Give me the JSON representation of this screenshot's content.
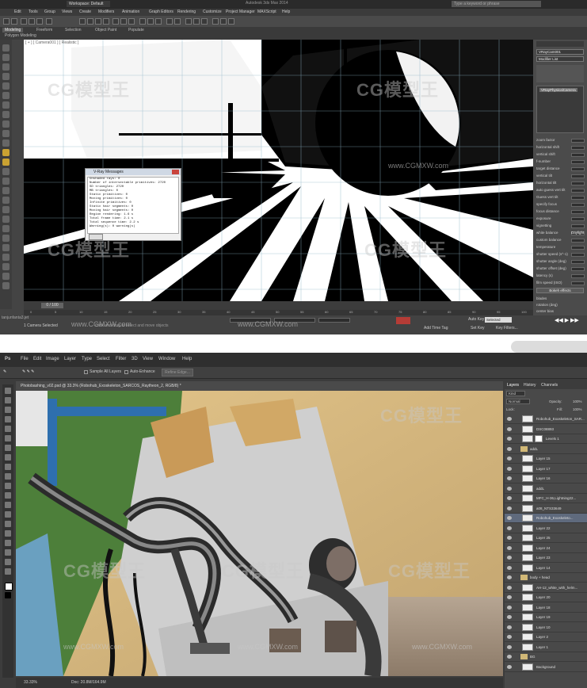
{
  "max": {
    "workspace": "Workspace: Default",
    "doc_title": "Autodesk 3ds Max 2014",
    "search_placeholder": "Type a keyword or phrase",
    "menu": [
      "Edit",
      "Tools",
      "Group",
      "Views",
      "Create",
      "Modifiers",
      "Animation",
      "Graph Editors",
      "Rendering",
      "Customize",
      "Project Manager",
      "MAXScript",
      "Help"
    ],
    "ribbon_tabs": [
      "Modeling",
      "Freeform",
      "Selection",
      "Object Paint",
      "Populate"
    ],
    "ribbon_sub": "Polygon Modeling",
    "viewport_label": "[ + ] [ Camera001 ] [ Realistic ]",
    "render_dialog": {
      "title": "V-Ray Messages",
      "lines": [
        "Unshaded rays: 0",
        "Number of intersectable primitives: 2720",
        "SD triangles: 2720",
        "MB triangles: 0",
        "Static primitives: 0",
        "Moving primitives: 0",
        "Infinite primitives: 0",
        "Static hair segments: 0",
        "Moving hair segments: 0",
        "Region rendering: 1.6 s",
        "Total frame time: 2.1 s",
        "Total sequence time: 2.2 s",
        "Warning(s): 0 warning(s)"
      ]
    },
    "command_panel": {
      "object_name": "VRayCam001",
      "modifier_list": "Modifier List",
      "stack_item": "VRayPhysicalCamera",
      "params": [
        "zoom factor",
        "horizontal shift",
        "vertical shift",
        "f-number",
        "target distance",
        "vertical tilt",
        "horizontal tilt",
        "auto guess vert tilt",
        "Guess vert tilt",
        "specify focus",
        "focus distance",
        "exposure",
        "vignetting",
        "white balance",
        "custom balance",
        "temperature",
        "shutter speed (s^-1)",
        "shutter angle (deg)",
        "shutter offset (deg)",
        "latency (s)",
        "film speed (ISO)"
      ],
      "white_balance": "Daylight",
      "rollout": "Bokeh effects",
      "blades": "blades",
      "rotation": "rotation (deg)",
      "center_bias": "center bias"
    },
    "timeline": {
      "frame": "0 / 100",
      "ticks": [
        "0",
        "5",
        "10",
        "15",
        "20",
        "25",
        "30",
        "35",
        "40",
        "45",
        "50",
        "55",
        "60",
        "65",
        "70",
        "75",
        "80",
        "85",
        "90",
        "95",
        "100"
      ]
    },
    "status": {
      "selected": "1 Camera Selected",
      "hint": "Click and drag to select and move objects",
      "auto_key": "Auto Key",
      "set_key": "Set Key",
      "selection": "Selected",
      "key_filters": "Key Filters...",
      "add_time_tag": "Add Time Tag",
      "lower_left": "tanjunfanta3.jet"
    }
  },
  "ps": {
    "menu": [
      "File",
      "Edit",
      "Image",
      "Layer",
      "Type",
      "Select",
      "Filter",
      "3D",
      "View",
      "Window",
      "Help"
    ],
    "options": {
      "sample_all": "Sample All Layers",
      "auto_enhance": "Auto-Enhance",
      "refine": "Refine Edge..."
    },
    "doc_tab": "Photobashing_v02.psd @ 33.3% (Robohub_Exoskeleton_SARCOS_Raytheon_2, RGB/8) *",
    "zoom": "33.33%",
    "doc_size": "Doc: 20.8M/164.9M",
    "panel_tabs": [
      "Layers",
      "History",
      "Channels"
    ],
    "kind": "Kind",
    "blend": "Normal",
    "opacity_label": "Opacity:",
    "opacity": "100%",
    "lock_label": "Lock:",
    "fill_label": "Fill:",
    "fill": "100%",
    "layers": [
      {
        "name": "Robohub_Exoskeleton_SAR...",
        "type": "layer"
      },
      {
        "name": "DSC08893",
        "type": "layer"
      },
      {
        "name": "Levels 1",
        "type": "adj"
      },
      {
        "name": "addL",
        "type": "group"
      },
      {
        "name": "Layer 15",
        "type": "layer"
      },
      {
        "name": "Layer 17",
        "type": "layer"
      },
      {
        "name": "Layer 16",
        "type": "layer"
      },
      {
        "name": "addL",
        "type": "layer"
      },
      {
        "name": "MFC_H-36,Lightning22...",
        "type": "layer"
      },
      {
        "name": "a08_NTS33649",
        "type": "layer"
      },
      {
        "name": "Robohub_Exoskeleto...",
        "type": "layer",
        "selected": true
      },
      {
        "name": "Layer 22",
        "type": "layer"
      },
      {
        "name": "Layer 25",
        "type": "layer"
      },
      {
        "name": "Layer 24",
        "type": "layer"
      },
      {
        "name": "Layer 23",
        "type": "layer"
      },
      {
        "name": "Layer 14",
        "type": "layer"
      },
      {
        "name": "body + head",
        "type": "group"
      },
      {
        "name": "AH-12_white_with_helm...",
        "type": "layer"
      },
      {
        "name": "Layer 20",
        "type": "layer"
      },
      {
        "name": "Layer 18",
        "type": "layer"
      },
      {
        "name": "Layer 19",
        "type": "layer"
      },
      {
        "name": "Layer 10",
        "type": "layer"
      },
      {
        "name": "Layer 2",
        "type": "layer"
      },
      {
        "name": "Layer 1",
        "type": "layer"
      },
      {
        "name": "BG",
        "type": "group"
      },
      {
        "name": "Background",
        "type": "layer"
      }
    ]
  },
  "watermark": {
    "logo": "CG模型王",
    "url": "www.CGMXW.com"
  }
}
